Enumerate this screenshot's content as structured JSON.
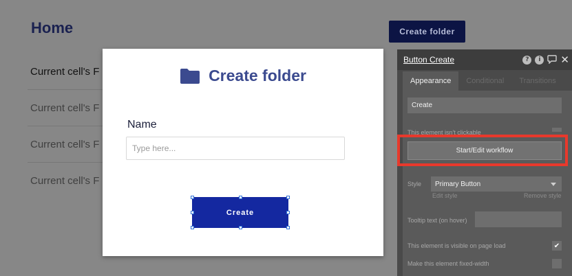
{
  "page": {
    "title": "Home",
    "top_button_label": "Create folder",
    "rows": [
      "Current cell's F",
      "Current cell's F",
      "Current cell's F",
      "Current cell's F"
    ]
  },
  "modal": {
    "icon": "folder-icon",
    "title": "Create folder",
    "name_label": "Name",
    "name_placeholder": "Type here...",
    "name_value": "",
    "create_label": "Create"
  },
  "panel": {
    "title": "Button Create",
    "header_icons": [
      "help-icon",
      "info-icon",
      "comment-icon",
      "close-icon"
    ],
    "tabs": [
      "Appearance",
      "Conditional",
      "Transitions"
    ],
    "active_tab": "Appearance",
    "text_value": "Create",
    "not_clickable_label": "This element isn't clickable",
    "workflow_button": "Start/Edit workflow",
    "style_label": "Style",
    "style_value": "Primary Button",
    "edit_style": "Edit style",
    "remove_style": "Remove style",
    "tooltip_label": "Tooltip text (on hover)",
    "tooltip_value": "",
    "visible_label": "This element is visible on page load",
    "visible_checked": true,
    "fixed_width_label": "Make this element fixed-width",
    "fixed_width_checked": false
  },
  "colors": {
    "modal_title": "#3b4a8f",
    "create_button": "#1428a0",
    "highlight": "#e8392c",
    "top_button": "#0c1444"
  }
}
